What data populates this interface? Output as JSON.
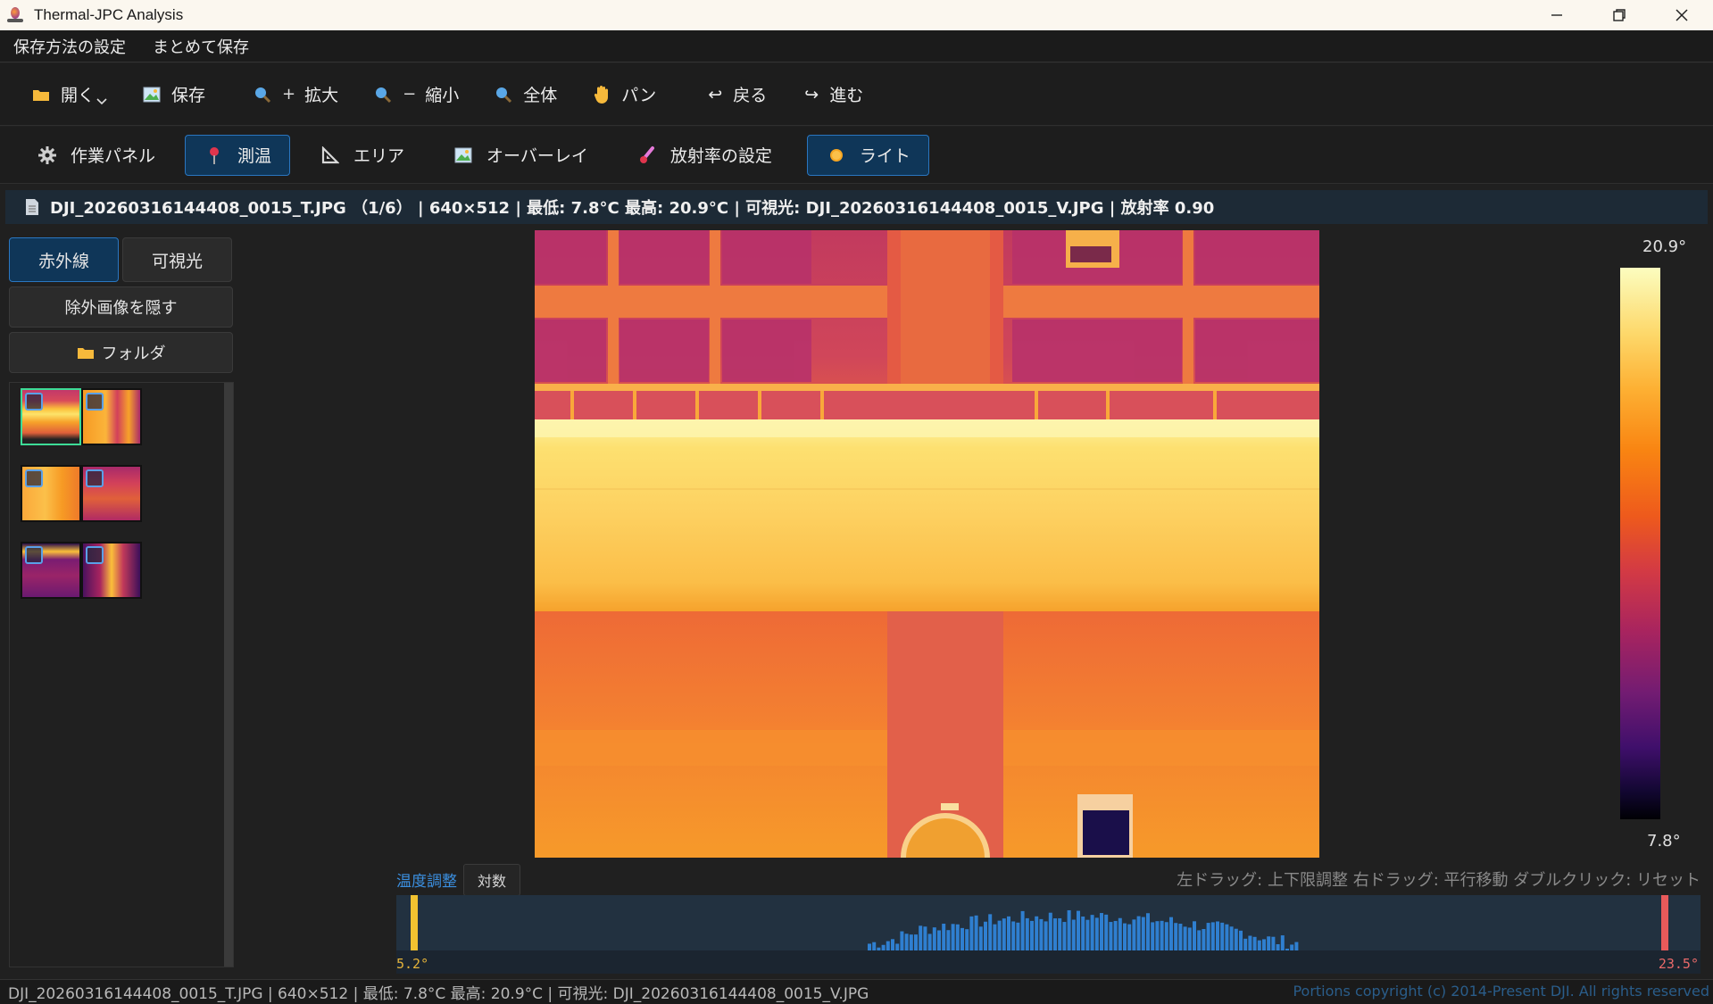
{
  "window": {
    "title": "Thermal-JPC Analysis"
  },
  "menu": [
    "保存方法の設定",
    "まとめて保存"
  ],
  "toolbar": {
    "open": "開く",
    "save": "保存",
    "zoom_in_sym": "+",
    "zoom_in": "拡大",
    "zoom_out_sym": "−",
    "zoom_out": "縮小",
    "fit": "全体",
    "pan": "パン",
    "back": "戻る",
    "forward": "進む"
  },
  "toolbar2": {
    "work_panel": "作業パネル",
    "measure": "測温",
    "area": "エリア",
    "overlay": "オーバーレイ",
    "emissivity": "放射率の設定",
    "light": "ライト"
  },
  "info": {
    "text": "DJI_20260316144408_0015_T.JPG （1/6） |  640×512  |  最低: 7.8°C  最高: 20.9°C  |  可視光: DJI_20260316144408_0015_V.JPG  |  放射率 0.90"
  },
  "left": {
    "infrared": "赤外線",
    "visible": "可視光",
    "hide_excluded": "除外画像を隠す",
    "folder": "フォルダ"
  },
  "scale": {
    "max": "20.9°",
    "min": "7.8°"
  },
  "temp_adjust": {
    "label": "温度調整",
    "log": "対数",
    "hint": "左ドラッグ: 上下限調整   右ドラッグ: 平行移動   ダブルクリック: リセット",
    "min": "5.2°",
    "max": "23.5°"
  },
  "status": {
    "text": "DJI_20260316144408_0015_T.JPG  |  640×512  |  最低: 7.8°C   最高: 20.9°C  |  可視光: DJI_20260316144408_0015_V.JPG",
    "copyright": "Portions copyright (c) 2014-Present DJI. All rights reserved"
  },
  "colors": {
    "accent": "#2a76c0",
    "active_bg": "#0f3658",
    "selected_thumb": "#3ddc97"
  }
}
